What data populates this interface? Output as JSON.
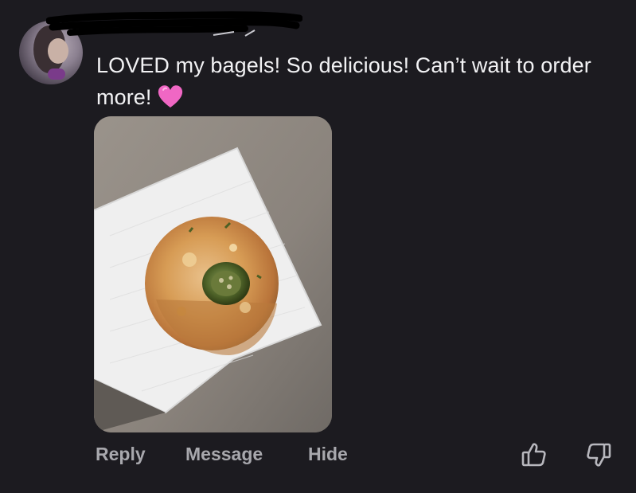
{
  "comment": {
    "author_name": "",
    "text": "LOVED my bagels! So delicious! Can’t wait to order more!",
    "emoji": "pink-heart"
  },
  "photo": {
    "subject": "jalapeño cheese bagel on paper towel"
  },
  "actions": {
    "reply_label": "Reply",
    "message_label": "Message",
    "hide_label": "Hide",
    "like_icon": "thumbs-up-icon",
    "dislike_icon": "thumbs-down-icon"
  },
  "colors": {
    "background": "#1c1b20",
    "text": "#f2f2f4",
    "action_text": "#a8a8ad",
    "heart": "#f067c4"
  }
}
